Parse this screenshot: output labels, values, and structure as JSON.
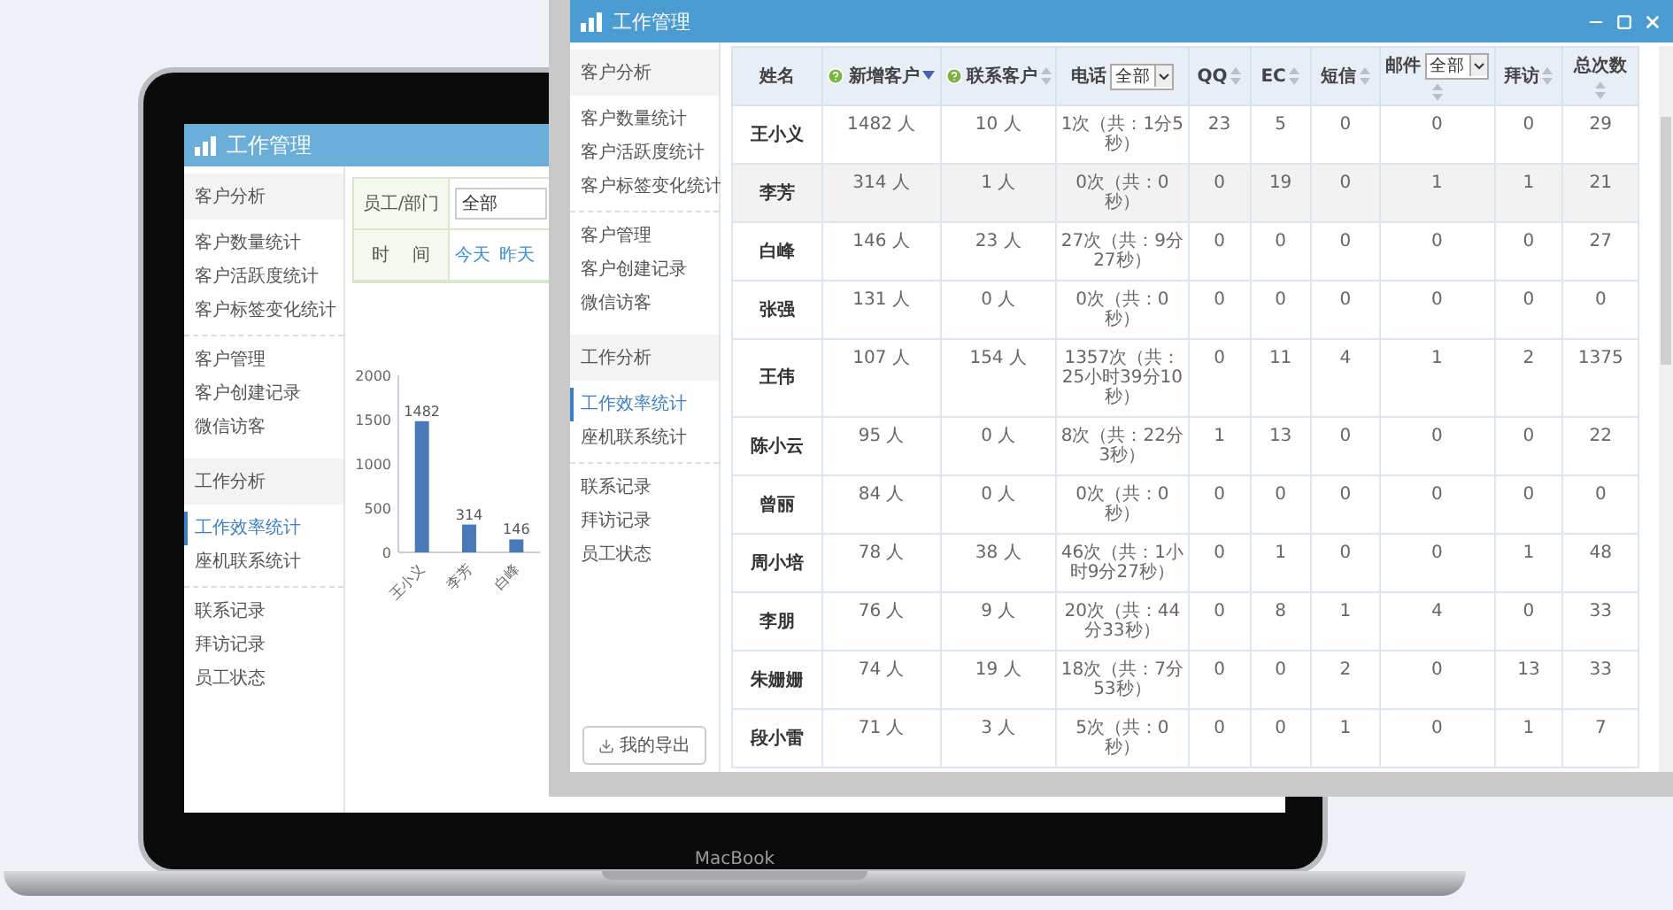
{
  "laptop": {
    "brand": "MacBook",
    "screen": {
      "title": "工作管理",
      "sidebar": [
        {
          "heading": "客户分析",
          "items": [
            {
              "label": "客户数量统计",
              "selected": false
            },
            {
              "label": "客户活跃度统计",
              "selected": false
            },
            {
              "label": "客户标签变化统计",
              "selected": false
            }
          ]
        },
        {
          "items": [
            {
              "label": "客户管理",
              "selected": false
            },
            {
              "label": "客户创建记录",
              "selected": false
            },
            {
              "label": "微信访客",
              "selected": false
            }
          ]
        },
        {
          "heading": "工作分析",
          "items": [
            {
              "label": "工作效率统计",
              "selected": true
            },
            {
              "label": "座机联系统计",
              "selected": false
            }
          ]
        },
        {
          "items": [
            {
              "label": "联系记录",
              "selected": false
            },
            {
              "label": "拜访记录",
              "selected": false
            },
            {
              "label": "员工状态",
              "selected": false
            }
          ]
        }
      ],
      "filters": [
        {
          "label": "员工/部门",
          "kind": "select",
          "value": "全部"
        },
        {
          "label": "时 间",
          "kind": "links",
          "links": [
            "今天",
            "昨天"
          ]
        }
      ],
      "chart_data": {
        "type": "bar",
        "categories": [
          "王小义",
          "李芳",
          "白峰"
        ],
        "values": [
          1482,
          314,
          146
        ],
        "ylim": [
          0,
          2000
        ],
        "yticks": [
          0,
          500,
          1000,
          1500,
          2000
        ],
        "data_labels": true
      }
    }
  },
  "window": {
    "title": "工作管理",
    "sidebar": [
      {
        "heading": "客户分析",
        "items": [
          {
            "label": "客户数量统计",
            "selected": false
          },
          {
            "label": "客户活跃度统计",
            "selected": false
          },
          {
            "label": "客户标签变化统计",
            "selected": false
          }
        ]
      },
      {
        "items": [
          {
            "label": "客户管理",
            "selected": false
          },
          {
            "label": "客户创建记录",
            "selected": false
          },
          {
            "label": "微信访客",
            "selected": false
          }
        ]
      },
      {
        "heading": "工作分析",
        "items": [
          {
            "label": "工作效率统计",
            "selected": true
          },
          {
            "label": "座机联系统计",
            "selected": false
          }
        ]
      },
      {
        "items": [
          {
            "label": "联系记录",
            "selected": false
          },
          {
            "label": "拜访记录",
            "selected": false
          },
          {
            "label": "员工状态",
            "selected": false
          }
        ]
      }
    ],
    "export_button": "我的导出",
    "table": {
      "columns": [
        {
          "label": "姓名",
          "help": false,
          "sortable": false
        },
        {
          "label": "新增客户",
          "help": true,
          "sortable": true,
          "sorted": true
        },
        {
          "label": "联系客户",
          "help": true,
          "sortable": true,
          "sorted": false
        },
        {
          "label": "电话",
          "help": false,
          "sortable": false,
          "filter": "全部"
        },
        {
          "label": "QQ",
          "help": false,
          "sortable": true,
          "sorted": false
        },
        {
          "label": "EC",
          "help": false,
          "sortable": true,
          "sorted": false
        },
        {
          "label": "短信",
          "help": false,
          "sortable": true,
          "sorted": false
        },
        {
          "label": "邮件",
          "help": false,
          "sortable": true,
          "sorted": false,
          "filter": "全部"
        },
        {
          "label": "拜访",
          "help": false,
          "sortable": true,
          "sorted": false
        },
        {
          "label": "总次数",
          "help": false,
          "sortable": true,
          "sorted": false
        }
      ],
      "rows": [
        {
          "selected": false,
          "cells": [
            "王小义",
            "1482 人",
            "10 人",
            "1次（共：1分5秒）",
            "23",
            "5",
            "0",
            "0",
            "0",
            "29"
          ]
        },
        {
          "selected": true,
          "cells": [
            "李芳",
            "314 人",
            "1 人",
            "0次（共：0秒）",
            "0",
            "19",
            "0",
            "1",
            "1",
            "21"
          ]
        },
        {
          "selected": false,
          "cells": [
            "白峰",
            "146 人",
            "23 人",
            "27次（共：9分27秒）",
            "0",
            "0",
            "0",
            "0",
            "0",
            "27"
          ]
        },
        {
          "selected": false,
          "cells": [
            "张强",
            "131 人",
            "0 人",
            "0次（共：0秒）",
            "0",
            "0",
            "0",
            "0",
            "0",
            "0"
          ]
        },
        {
          "selected": false,
          "cells": [
            "王伟",
            "107 人",
            "154 人",
            "1357次（共：25小时39分10秒）",
            "0",
            "11",
            "4",
            "1",
            "2",
            "1375"
          ]
        },
        {
          "selected": false,
          "cells": [
            "陈小云",
            "95 人",
            "0 人",
            "8次（共：22分3秒）",
            "1",
            "13",
            "0",
            "0",
            "0",
            "22"
          ]
        },
        {
          "selected": false,
          "cells": [
            "曾丽",
            "84 人",
            "0 人",
            "0次（共：0秒）",
            "0",
            "0",
            "0",
            "0",
            "0",
            "0"
          ]
        },
        {
          "selected": false,
          "cells": [
            "周小培",
            "78 人",
            "38 人",
            "46次（共：1小时9分27秒）",
            "0",
            "1",
            "0",
            "0",
            "1",
            "48"
          ]
        },
        {
          "selected": false,
          "cells": [
            "李朋",
            "76 人",
            "9 人",
            "20次（共：44分33秒）",
            "0",
            "8",
            "1",
            "4",
            "0",
            "33"
          ]
        },
        {
          "selected": false,
          "cells": [
            "朱姗姗",
            "74 人",
            "19 人",
            "18次（共：7分53秒）",
            "0",
            "0",
            "2",
            "0",
            "13",
            "33"
          ]
        },
        {
          "selected": false,
          "cells": [
            "段小雷",
            "71 人",
            "3 人",
            "5次（共：0秒）",
            "0",
            "0",
            "1",
            "0",
            "1",
            "7"
          ]
        }
      ]
    }
  }
}
